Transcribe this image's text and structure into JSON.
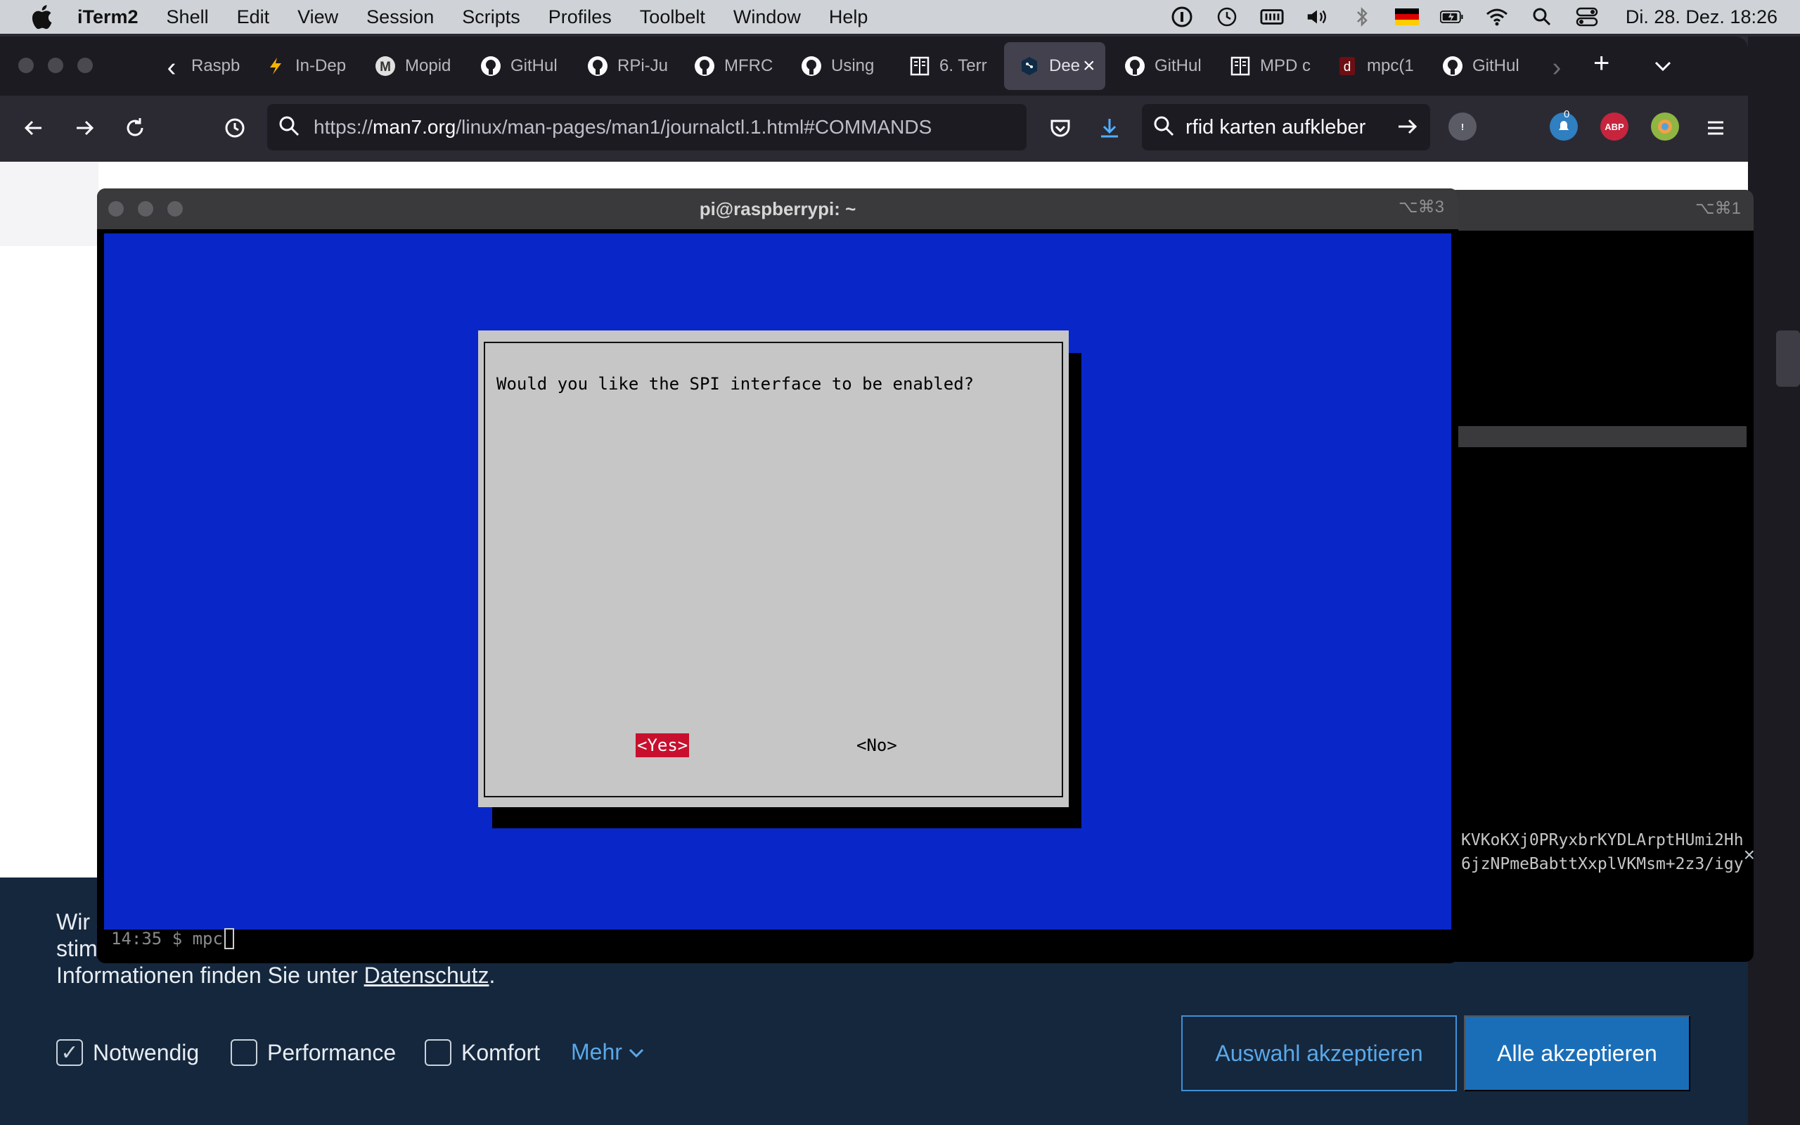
{
  "menubar": {
    "app": "iTerm2",
    "items": [
      "Shell",
      "Edit",
      "View",
      "Session",
      "Scripts",
      "Profiles",
      "Toolbelt",
      "Window",
      "Help"
    ],
    "clock": "Di. 28. Dez.  18:26"
  },
  "browser": {
    "tabs": [
      {
        "label": "Raspb",
        "icon": "raspberry-icon"
      },
      {
        "label": "In-Dep",
        "icon": "bolt-icon"
      },
      {
        "label": "Mopid",
        "icon": "m-icon"
      },
      {
        "label": "GitHul",
        "icon": "github-icon"
      },
      {
        "label": "RPi-Ju",
        "icon": "github-icon"
      },
      {
        "label": "MFRC",
        "icon": "github-icon"
      },
      {
        "label": "Using",
        "icon": "github-icon"
      },
      {
        "label": "6. Terr",
        "icon": "book-icon"
      },
      {
        "label": "Dee",
        "icon": "deepl-icon",
        "active": true
      },
      {
        "label": "GitHul",
        "icon": "github-icon"
      },
      {
        "label": "MPD c",
        "icon": "book-icon"
      },
      {
        "label": "mpc(1",
        "icon": "d-icon"
      },
      {
        "label": "GitHul",
        "icon": "github-icon"
      }
    ],
    "url": {
      "prefix": "https://",
      "host": "man7.org",
      "path": "/linux/man-pages/man1/journalctl.1.html#COMMANDS"
    },
    "search_query": "rfid karten aufkleber",
    "notification_count": "0",
    "abp_label": "ABP"
  },
  "cookie_banner": {
    "line1": "Wir s",
    "line2": "stimr",
    "line3_prefix": "Informationen finden Sie unter ",
    "link": "Datenschutz",
    "line3_suffix": ".",
    "checkbox_notwendig": "Notwendig",
    "checkbox_performance": "Performance",
    "checkbox_komfort": "Komfort",
    "mehr": "Mehr",
    "btn_auswahl": "Auswahl akzeptieren",
    "btn_alle": "Alle akzeptieren"
  },
  "terminal": {
    "title": "pi@raspberrypi: ~",
    "hotkey": "⌥⌘3",
    "question": "Would you like the SPI interface to be enabled?",
    "yes": "<Yes>",
    "no": "<No>",
    "status_line": "14:35 $ mpc"
  },
  "terminal_back": {
    "hotkey": "⌥⌘1",
    "line1": "KVKoKXj0PRyxbrKYDLArptHUmi2Hh",
    "line2": "6jzNPmeBabttXxplVKMsm+2z3/igy"
  }
}
